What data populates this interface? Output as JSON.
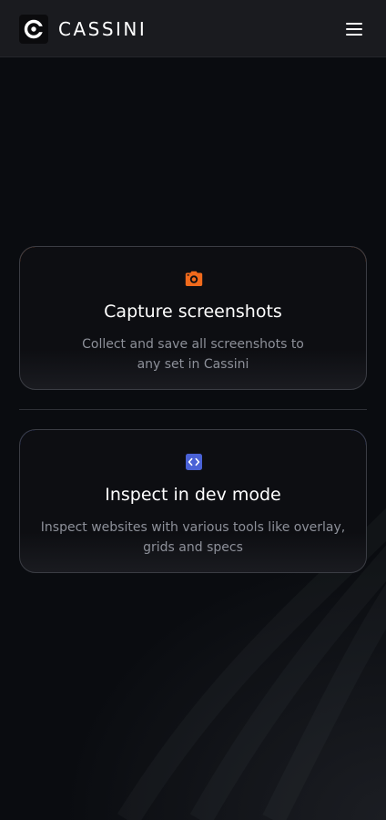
{
  "header": {
    "brand_name": "CASSINI",
    "logo_icon": "cassini-logo-icon",
    "menu_icon": "hamburger-menu-icon"
  },
  "cards": [
    {
      "icon": "camera-icon",
      "accent_color": "#f06a1c",
      "title": "Capture screenshots",
      "description_lines": [
        "Collect and save all screenshots to",
        "any set in Cassini"
      ]
    },
    {
      "icon": "code-icon",
      "accent_color": "#2f4fe0",
      "title": "Inspect in dev mode",
      "description_lines": [
        "Inspect websites with various tools like overlay,",
        "grids and specs"
      ]
    }
  ],
  "colors": {
    "background": "#0a0c10",
    "header_background": "#1a1b1f",
    "muted_text": "#8d9099"
  }
}
